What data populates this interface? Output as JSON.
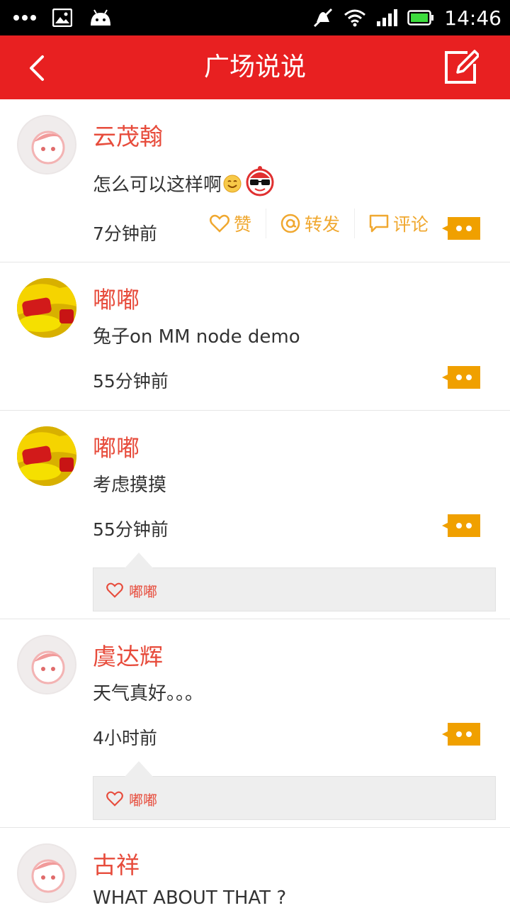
{
  "status_bar": {
    "time": "14:46"
  },
  "header": {
    "title": "广场说说"
  },
  "posts": [
    {
      "name": "云茂翰",
      "text": "怎么可以这样啊",
      "time": "7分钟前",
      "avatar": "default-avatar",
      "actions": {
        "like": "赞",
        "forward": "转发",
        "comment": "评论"
      }
    },
    {
      "name": "嘟嘟",
      "text": "兔子on MM node demo",
      "time": "55分钟前",
      "avatar": "photo-avatar"
    },
    {
      "name": "嘟嘟",
      "text": "考虑摸摸",
      "time": "55分钟前",
      "avatar": "photo-avatar",
      "likers": "嘟嘟"
    },
    {
      "name": "虞达辉",
      "text": "天气真好。。。",
      "time": "4小时前",
      "avatar": "default-avatar",
      "likers": "嘟嘟"
    },
    {
      "name": "古祥",
      "text": "WHAT ABOUT THAT ?",
      "avatar": "default-avatar"
    }
  ],
  "colors": {
    "header": "#e82021",
    "name": "#e74c3c",
    "action": "#f0a830",
    "more_button": "#f0a000"
  }
}
